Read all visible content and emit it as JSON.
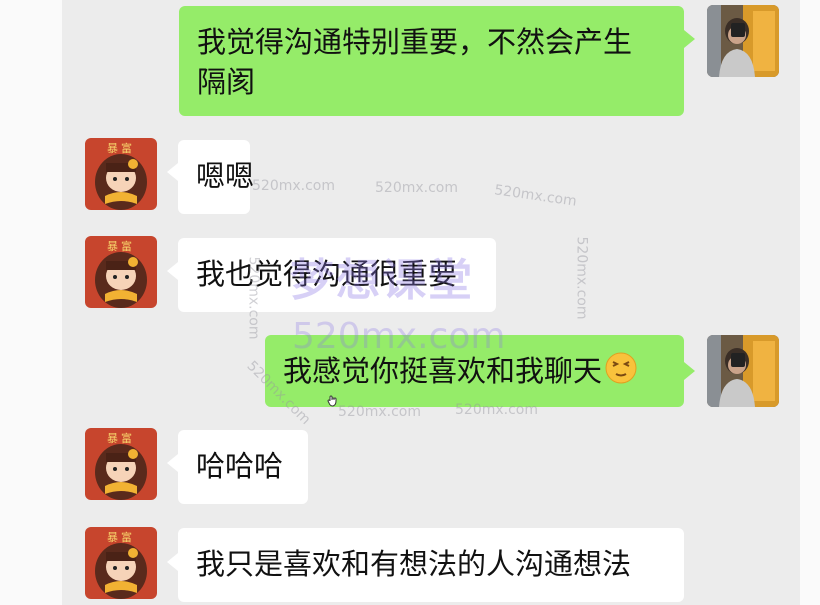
{
  "watermark": {
    "brand": "梦想课堂",
    "site": "520mx.com",
    "small_1": "520mx.com",
    "small_2": "520mx.com",
    "small_3": "520mx.com",
    "small_4": "520mx.com",
    "small_5": "520mx.com",
    "small_6": "520mx.com",
    "small_7": "520mx.com",
    "small_8": "520mx.com"
  },
  "avatar_stamp": "暴富",
  "messages": [
    {
      "side": "out",
      "text_line1": "我觉得沟通特别重要，不然会产生",
      "text_line2": "隔阂"
    },
    {
      "side": "in",
      "text": "嗯嗯"
    },
    {
      "side": "in",
      "text": "我也觉得沟通很重要"
    },
    {
      "side": "out",
      "text": "我感觉你挺喜欢和我聊天",
      "emoji": "smiling-face-icon"
    },
    {
      "side": "in",
      "text": "哈哈哈"
    },
    {
      "side": "in",
      "text": "我只是喜欢和有想法的人沟通想法"
    }
  ],
  "colors": {
    "outgoing_bubble": "#95ec69",
    "incoming_bubble": "#ffffff",
    "chat_background": "#ececec"
  }
}
